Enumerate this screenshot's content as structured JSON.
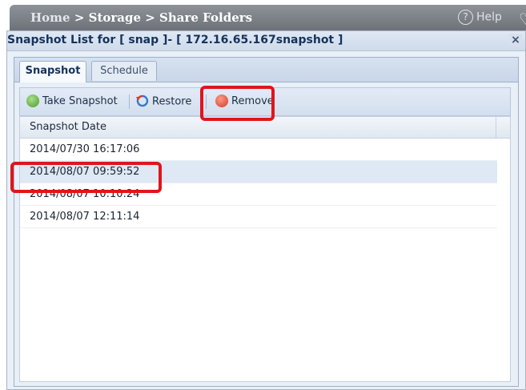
{
  "topbar": {
    "breadcrumb": {
      "home": "Home",
      "sep1": " > ",
      "storage": "Storage",
      "sep2": " > ",
      "page": "Share Folders"
    },
    "help_label": "Help"
  },
  "dialog": {
    "title": "Snapshot List for [ snap ]- [ 172.16.65.167snapshot ]",
    "close_glyph": "×"
  },
  "tabs": [
    {
      "label": "Snapshot",
      "active": true
    },
    {
      "label": "Schedule",
      "active": false
    }
  ],
  "toolbar": {
    "take_snapshot": "Take Snapshot",
    "restore": "Restore",
    "remove": "Remove"
  },
  "grid": {
    "column_header": "Snapshot Date",
    "rows": [
      {
        "date": "2014/07/30 16:17:06",
        "selected": false
      },
      {
        "date": "2014/08/07 09:59:52",
        "selected": true
      },
      {
        "date": "2014/08/07 10:10:24",
        "selected": false
      },
      {
        "date": "2014/08/07 12:11:14",
        "selected": false
      }
    ]
  },
  "icons": {
    "help": "help-circle-icon",
    "heart": "heart-icon",
    "close": "close-icon",
    "take_snapshot": "add-circle-icon",
    "restore": "restore-icon",
    "remove": "remove-circle-icon"
  },
  "colors": {
    "highlight_annotation": "#e0151b",
    "selected_row": "#dfe8f5",
    "topbar": "#7f838a"
  }
}
